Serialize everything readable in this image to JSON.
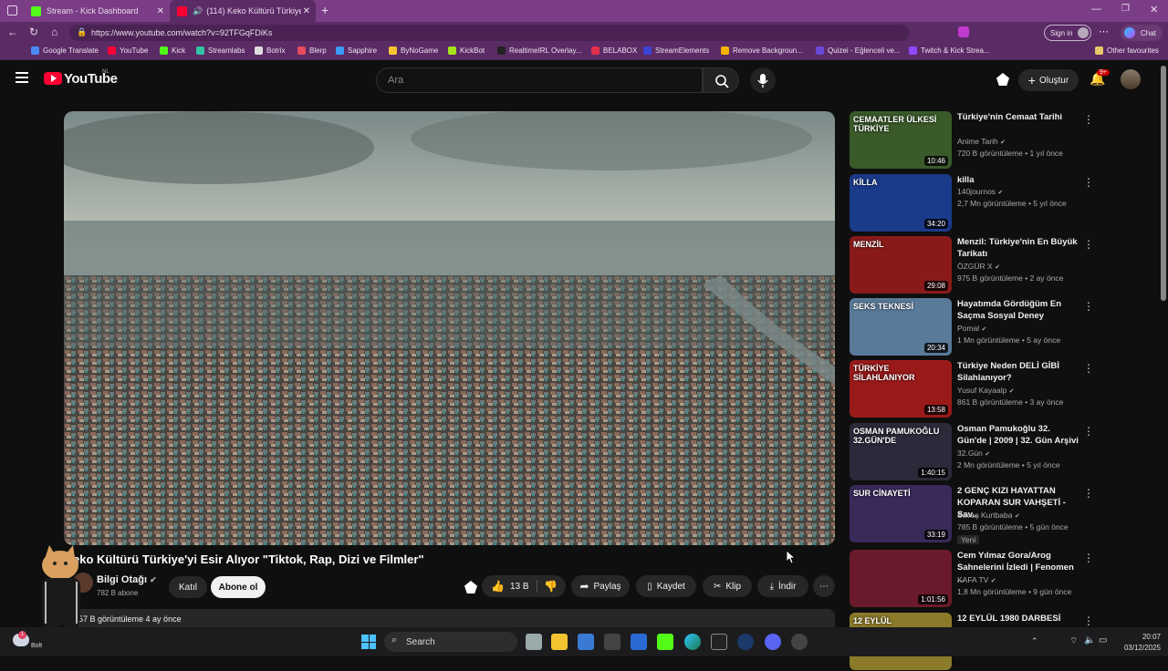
{
  "browser": {
    "tabs": [
      {
        "label": "Stream - Kick Dashboard"
      },
      {
        "label": "(114) Keko Kültürü Türkiye'yi..."
      }
    ],
    "url": "https://www.youtube.com/watch?v=92TFGqFDiKs",
    "sign_in": "Sign in",
    "chat": "Chat",
    "bookmarks": [
      "Google Translate",
      "YouTube",
      "Kick",
      "Streamlabs",
      "Botrix",
      "Blerp",
      "Sapphire",
      "ByNoGame",
      "KickBot",
      "RealtimeIRL Overlay...",
      "BELABOX",
      "StreamElements",
      "Remove Backgroun...",
      "Quizei - Eğlenceli ve...",
      "Twitch & Kick Strea..."
    ],
    "other_favourites": "Other favourites"
  },
  "youtube": {
    "logo": "YouTube",
    "region": "NL",
    "search_placeholder": "Ara",
    "create": "Oluştur",
    "notif_count": "9+"
  },
  "video": {
    "title": "eko Kültürü Türkiye'yi Esir Alıyor \"Tiktok, Rap, Dizi ve Filmler\"",
    "channel": "Bilgi Otağı",
    "subs": "782 B abone",
    "join": "Katıl",
    "subscribe": "Abone ol",
    "likes": "13 B",
    "share": "Paylaş",
    "save": "Kaydet",
    "clip": "Klip",
    "download": "İndir",
    "views": "57 B görüntüleme  4 ay önce"
  },
  "recommendations": [
    {
      "title": "Türkiye'nin Cemaat Tarihi",
      "channel": "Anime Tarih",
      "meta": "720 B görüntüleme • 1 yıl önce",
      "duration": "10:46",
      "thumb_text": "CEMAATLER ÜLKESİ TÜRKİYE",
      "color": "#3a5a2a"
    },
    {
      "title": "killa",
      "channel": "140journos",
      "meta": "2,7 Mn görüntüleme • 5 yıl önce",
      "duration": "34:20",
      "thumb_text": "KİLLA",
      "color": "#1a3a8a"
    },
    {
      "title": "Menzil: Türkiye'nin En Büyük Tarikatı",
      "channel": "ÖZGÜR X",
      "meta": "975 B görüntüleme • 2 ay önce",
      "duration": "29:08",
      "thumb_text": "MENZİL",
      "color": "#8a1a1a"
    },
    {
      "title": "Hayatımda Gördüğüm En Saçma Sosyal Deney",
      "channel": "Pomal",
      "meta": "1 Mn görüntüleme • 5 ay önce",
      "duration": "20:34",
      "thumb_text": "SEKS TEKNESİ",
      "color": "#5a7a9a"
    },
    {
      "title": "Türkiye Neden DELİ GİBİ Silahlanıyor?",
      "channel": "Yusuf Kayaalp",
      "meta": "861 B görüntüleme • 3 ay önce",
      "duration": "13:58",
      "thumb_text": "TÜRKİYE SİLAHLANIYOR",
      "color": "#9a1a1a"
    },
    {
      "title": "Osman Pamukoğlu 32. Gün'de | 2009 | 32. Gün Arşivi",
      "channel": "32.Gün",
      "meta": "2 Mn görüntüleme • 5 yıl önce",
      "duration": "1:40:15",
      "thumb_text": "OSMAN PAMUKOĞLU 32.GÜN'DE",
      "color": "#2a2a3a"
    },
    {
      "title": "2 GENÇ KIZI HAYATTAN KOPARAN SUR VAHŞETİ - Sav...",
      "channel": "Savaş Kurtbaba",
      "meta": "785 B görüntüleme • 5 gün önce",
      "duration": "33:19",
      "thumb_text": "SUR CİNAYETİ",
      "color": "#3a2a5a",
      "badge": "Yeni"
    },
    {
      "title": "Cem Yılmaz Gora/Arog Sahnelerini İzledi | Fenomen ...",
      "channel": "KAFA TV",
      "meta": "1,8 Mn görüntüleme • 9 gün önce",
      "duration": "1:01:56",
      "thumb_text": "",
      "color": "#6a1a2a"
    },
    {
      "title": "12 EYLÜL 1980 DARBESİ",
      "channel": "",
      "meta": "",
      "duration": "",
      "thumb_text": "12 EYLÜL",
      "color": "#8a7a2a"
    }
  ],
  "taskbar": {
    "weather": "Bolt",
    "search": "Search",
    "time": "20:07",
    "date": "03/12/2025"
  }
}
